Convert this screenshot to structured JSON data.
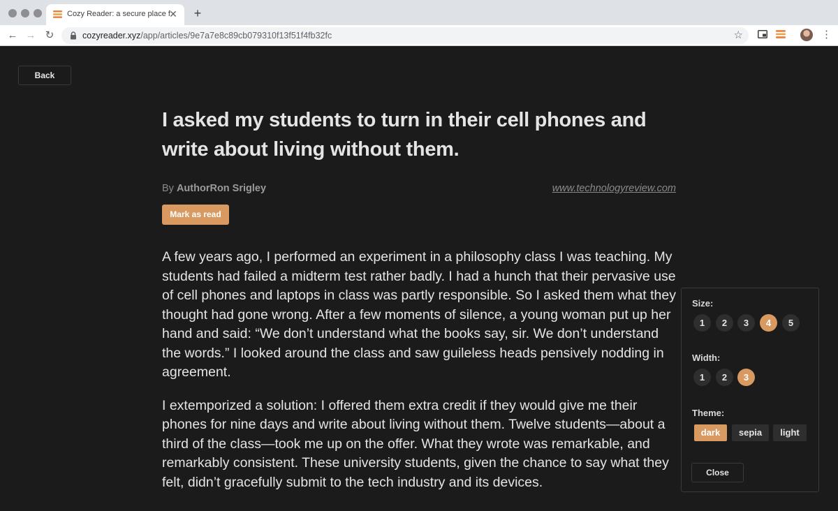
{
  "browser": {
    "tab_title": "Cozy Reader: a secure place for your reading",
    "url_host": "cozyreader.xyz",
    "url_path": "/app/articles/9e7a7e8c89cb079310f13f51f4fb32fc"
  },
  "reader": {
    "back_label": "Back",
    "title": "I asked my students to turn in their cell phones and write about living without them.",
    "by_prefix": "By",
    "author": "AuthorRon Srigley",
    "source": "www.technologyreview.com",
    "mark_read_label": "Mark as read",
    "paragraphs": [
      "A few years ago, I performed an experiment in a philosophy class I was teaching. My students had failed a midterm test rather badly. I had a hunch that their pervasive use of cell phones and laptops in class was partly responsible. So I asked them what they thought had gone wrong. After a few moments of silence, a young woman put up her hand and said: “We don’t understand what the books say, sir. We don’t understand the words.” I looked around the class and saw guileless heads pensively nodding in agreement.",
      "I extemporized a solution: I offered them extra credit if they would give me their phones for nine days and write about living without them. Twelve students—about a third of the class—took me up on the offer. What they wrote was remarkable, and remarkably consistent. These university students, given the chance to say what they felt, didn’t gracefully submit to the tech industry and its devices."
    ]
  },
  "settings": {
    "size_label": "Size:",
    "sizes": [
      "1",
      "2",
      "3",
      "4",
      "5"
    ],
    "size_selected": "4",
    "width_label": "Width:",
    "widths": [
      "1",
      "2",
      "3"
    ],
    "width_selected": "3",
    "theme_label": "Theme:",
    "themes": [
      "dark",
      "sepia",
      "light"
    ],
    "theme_selected": "dark",
    "close_label": "Close"
  },
  "colors": {
    "accent": "#d89a61",
    "background": "#1b1b1b",
    "text": "#e4e4e4"
  }
}
